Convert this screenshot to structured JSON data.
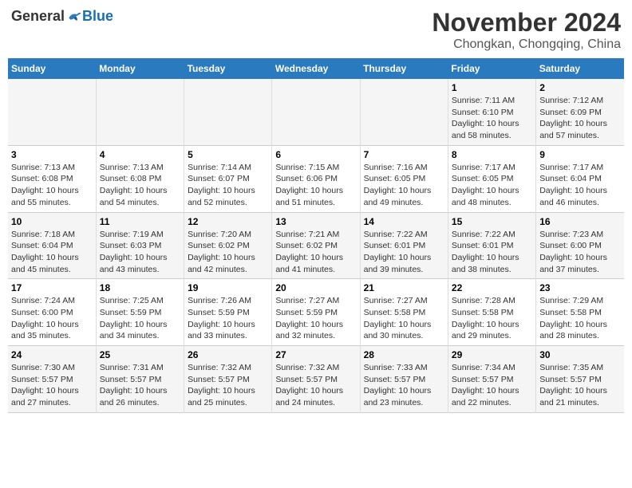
{
  "header": {
    "logo_general": "General",
    "logo_blue": "Blue",
    "month": "November 2024",
    "location": "Chongkan, Chongqing, China"
  },
  "columns": [
    "Sunday",
    "Monday",
    "Tuesday",
    "Wednesday",
    "Thursday",
    "Friday",
    "Saturday"
  ],
  "weeks": [
    [
      {
        "day": "",
        "info": ""
      },
      {
        "day": "",
        "info": ""
      },
      {
        "day": "",
        "info": ""
      },
      {
        "day": "",
        "info": ""
      },
      {
        "day": "",
        "info": ""
      },
      {
        "day": "1",
        "info": "Sunrise: 7:11 AM\nSunset: 6:10 PM\nDaylight: 10 hours and 58 minutes."
      },
      {
        "day": "2",
        "info": "Sunrise: 7:12 AM\nSunset: 6:09 PM\nDaylight: 10 hours and 57 minutes."
      }
    ],
    [
      {
        "day": "3",
        "info": "Sunrise: 7:13 AM\nSunset: 6:08 PM\nDaylight: 10 hours and 55 minutes."
      },
      {
        "day": "4",
        "info": "Sunrise: 7:13 AM\nSunset: 6:08 PM\nDaylight: 10 hours and 54 minutes."
      },
      {
        "day": "5",
        "info": "Sunrise: 7:14 AM\nSunset: 6:07 PM\nDaylight: 10 hours and 52 minutes."
      },
      {
        "day": "6",
        "info": "Sunrise: 7:15 AM\nSunset: 6:06 PM\nDaylight: 10 hours and 51 minutes."
      },
      {
        "day": "7",
        "info": "Sunrise: 7:16 AM\nSunset: 6:05 PM\nDaylight: 10 hours and 49 minutes."
      },
      {
        "day": "8",
        "info": "Sunrise: 7:17 AM\nSunset: 6:05 PM\nDaylight: 10 hours and 48 minutes."
      },
      {
        "day": "9",
        "info": "Sunrise: 7:17 AM\nSunset: 6:04 PM\nDaylight: 10 hours and 46 minutes."
      }
    ],
    [
      {
        "day": "10",
        "info": "Sunrise: 7:18 AM\nSunset: 6:04 PM\nDaylight: 10 hours and 45 minutes."
      },
      {
        "day": "11",
        "info": "Sunrise: 7:19 AM\nSunset: 6:03 PM\nDaylight: 10 hours and 43 minutes."
      },
      {
        "day": "12",
        "info": "Sunrise: 7:20 AM\nSunset: 6:02 PM\nDaylight: 10 hours and 42 minutes."
      },
      {
        "day": "13",
        "info": "Sunrise: 7:21 AM\nSunset: 6:02 PM\nDaylight: 10 hours and 41 minutes."
      },
      {
        "day": "14",
        "info": "Sunrise: 7:22 AM\nSunset: 6:01 PM\nDaylight: 10 hours and 39 minutes."
      },
      {
        "day": "15",
        "info": "Sunrise: 7:22 AM\nSunset: 6:01 PM\nDaylight: 10 hours and 38 minutes."
      },
      {
        "day": "16",
        "info": "Sunrise: 7:23 AM\nSunset: 6:00 PM\nDaylight: 10 hours and 37 minutes."
      }
    ],
    [
      {
        "day": "17",
        "info": "Sunrise: 7:24 AM\nSunset: 6:00 PM\nDaylight: 10 hours and 35 minutes."
      },
      {
        "day": "18",
        "info": "Sunrise: 7:25 AM\nSunset: 5:59 PM\nDaylight: 10 hours and 34 minutes."
      },
      {
        "day": "19",
        "info": "Sunrise: 7:26 AM\nSunset: 5:59 PM\nDaylight: 10 hours and 33 minutes."
      },
      {
        "day": "20",
        "info": "Sunrise: 7:27 AM\nSunset: 5:59 PM\nDaylight: 10 hours and 32 minutes."
      },
      {
        "day": "21",
        "info": "Sunrise: 7:27 AM\nSunset: 5:58 PM\nDaylight: 10 hours and 30 minutes."
      },
      {
        "day": "22",
        "info": "Sunrise: 7:28 AM\nSunset: 5:58 PM\nDaylight: 10 hours and 29 minutes."
      },
      {
        "day": "23",
        "info": "Sunrise: 7:29 AM\nSunset: 5:58 PM\nDaylight: 10 hours and 28 minutes."
      }
    ],
    [
      {
        "day": "24",
        "info": "Sunrise: 7:30 AM\nSunset: 5:57 PM\nDaylight: 10 hours and 27 minutes."
      },
      {
        "day": "25",
        "info": "Sunrise: 7:31 AM\nSunset: 5:57 PM\nDaylight: 10 hours and 26 minutes."
      },
      {
        "day": "26",
        "info": "Sunrise: 7:32 AM\nSunset: 5:57 PM\nDaylight: 10 hours and 25 minutes."
      },
      {
        "day": "27",
        "info": "Sunrise: 7:32 AM\nSunset: 5:57 PM\nDaylight: 10 hours and 24 minutes."
      },
      {
        "day": "28",
        "info": "Sunrise: 7:33 AM\nSunset: 5:57 PM\nDaylight: 10 hours and 23 minutes."
      },
      {
        "day": "29",
        "info": "Sunrise: 7:34 AM\nSunset: 5:57 PM\nDaylight: 10 hours and 22 minutes."
      },
      {
        "day": "30",
        "info": "Sunrise: 7:35 AM\nSunset: 5:57 PM\nDaylight: 10 hours and 21 minutes."
      }
    ]
  ]
}
